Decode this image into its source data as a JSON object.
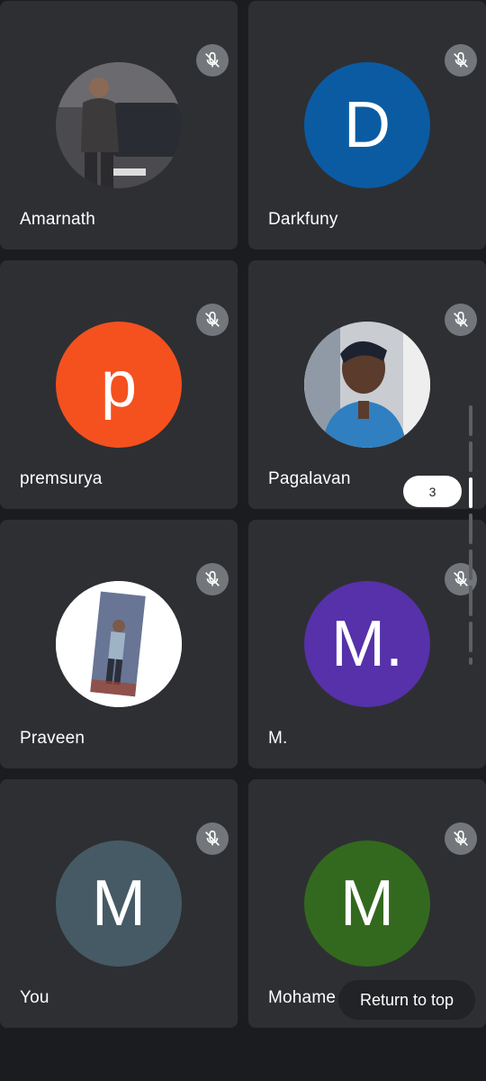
{
  "participants": [
    {
      "name": "Amarnath",
      "avatar_type": "photo",
      "avatar_bg": "#3a3b40",
      "muted": true
    },
    {
      "name": "Darkfuny",
      "avatar_type": "letter",
      "initial": "D",
      "avatar_bg": "#0b5ba3",
      "muted": true
    },
    {
      "name": "premsurya",
      "avatar_type": "letter",
      "initial": "p",
      "avatar_bg": "#f4511e",
      "muted": true
    },
    {
      "name": "Pagalavan",
      "avatar_type": "photo",
      "avatar_bg": "#d6d6d6",
      "muted": true
    },
    {
      "name": "Praveen",
      "avatar_type": "photo",
      "avatar_bg": "#ffffff",
      "muted": true
    },
    {
      "name": "M.",
      "avatar_type": "letter",
      "initial": "M.",
      "avatar_bg": "#5631a9",
      "muted": true
    },
    {
      "name": "You",
      "avatar_type": "letter",
      "initial": "M",
      "avatar_bg": "#455a64",
      "muted": true
    },
    {
      "name": "Mohame",
      "avatar_type": "letter",
      "initial": "M",
      "avatar_bg": "#33691e",
      "muted": true
    }
  ],
  "pagination": {
    "current_page": "3"
  },
  "return_to_top": {
    "label": "Return to top"
  },
  "icons": {
    "mute": "mic-off-icon"
  }
}
